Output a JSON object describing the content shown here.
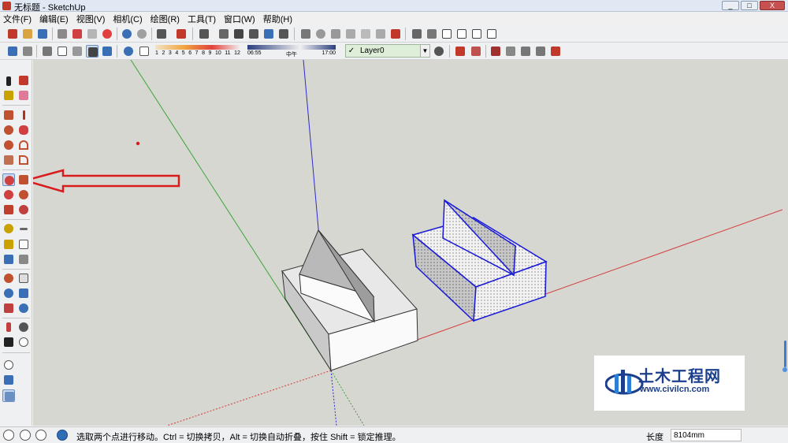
{
  "window": {
    "title": "无标题 - SketchUp",
    "buttons": [
      "_",
      "□",
      "X"
    ]
  },
  "menu": [
    "文件(F)",
    "编辑(E)",
    "视图(V)",
    "相机(C)",
    "绘图(R)",
    "工具(T)",
    "窗口(W)",
    "帮助(H)"
  ],
  "toolbar_top": {
    "icons": [
      "new-icon",
      "open-icon",
      "save-icon",
      "cut-icon",
      "copy-icon",
      "paste-icon",
      "erase-icon",
      "undo-icon",
      "redo-icon",
      "print-icon",
      "model-info-icon",
      "component-icon",
      "group-icon",
      "make-component-icon",
      "iso-view-icon",
      "top-view-icon",
      "front-view-icon",
      "right-view-icon",
      "back-view-icon",
      "left-view-icon",
      "camera-icon",
      "warehouse-icon",
      "share-icon",
      "house-icon",
      "home-icon",
      "shop-icon"
    ]
  },
  "toolbar_second": {
    "shadow_scale_ticks": [
      "1",
      "2",
      "3",
      "4",
      "5",
      "6",
      "7",
      "8",
      "9",
      "10",
      "11",
      "12"
    ],
    "time_start": "06:55",
    "time_mid": "中午",
    "time_end": "17:00",
    "layer_check": "✓",
    "layer_name": "Layer0",
    "layer_dd": "▼"
  },
  "status": {
    "message": "选取两个点进行移动。Ctrl = 切换拷贝，Alt = 切换自动折叠，按住 Shift = 锁定推理。",
    "vcb_label": "长度",
    "vcb_value": "8104mm"
  },
  "watermark": {
    "cn": "土木工程网",
    "url": "www.civilcn.com"
  },
  "colors": {
    "viewport_bg": "#d7d7d2",
    "axis_red": "#d33a3a",
    "axis_green": "#3aa53a",
    "axis_blue": "#2b2bd0",
    "selection": "#1a1ad6",
    "arrow": "#d81c1c"
  }
}
